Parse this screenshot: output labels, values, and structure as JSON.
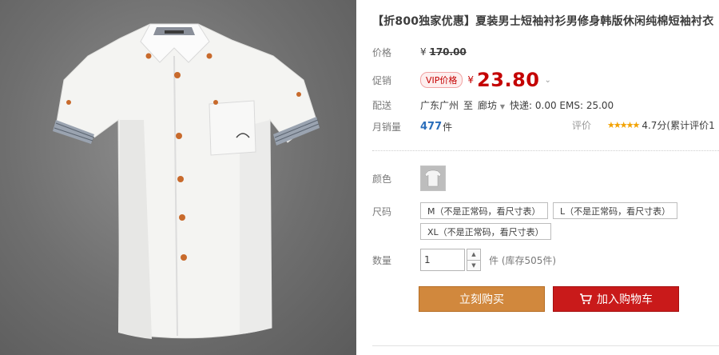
{
  "product": {
    "title": "【折800独家优惠】夏装男士短袖衬衫男修身韩版休闲纯棉短袖衬衣",
    "image_alt": "white short-sleeve shirt"
  },
  "price": {
    "label": "价格",
    "currency": "¥",
    "original": "170.00"
  },
  "promo": {
    "label": "促销",
    "badge": "VIP价格",
    "currency": "¥",
    "value": "23.80"
  },
  "shipping": {
    "label": "配送",
    "from": "广东广州",
    "to_word": "至",
    "destination": "廊坊",
    "fees": "快递: 0.00 EMS: 25.00"
  },
  "sales": {
    "label": "月销量",
    "count": "477",
    "unit": "件",
    "rating_label": "评价",
    "rating_value": "4.7分(累计评价1"
  },
  "options": {
    "color_label": "颜色",
    "size_label": "尺码",
    "sizes": [
      "M（不是正常码，看尺寸表）",
      "L（不是正常码，看尺寸表）",
      "XL（不是正常码，看尺寸表）"
    ],
    "qty_label": "数量",
    "qty_value": "1",
    "stock_text": "件 (库存505件)"
  },
  "actions": {
    "buy_now": "立刻购买",
    "add_to_cart": "加入购物车"
  },
  "colors": {
    "price_red": "#c40000",
    "buy_now_bg": "#d1883d",
    "add_cart_bg": "#c91a1a",
    "link_blue": "#2a6ebb",
    "star": "#f2a200"
  }
}
